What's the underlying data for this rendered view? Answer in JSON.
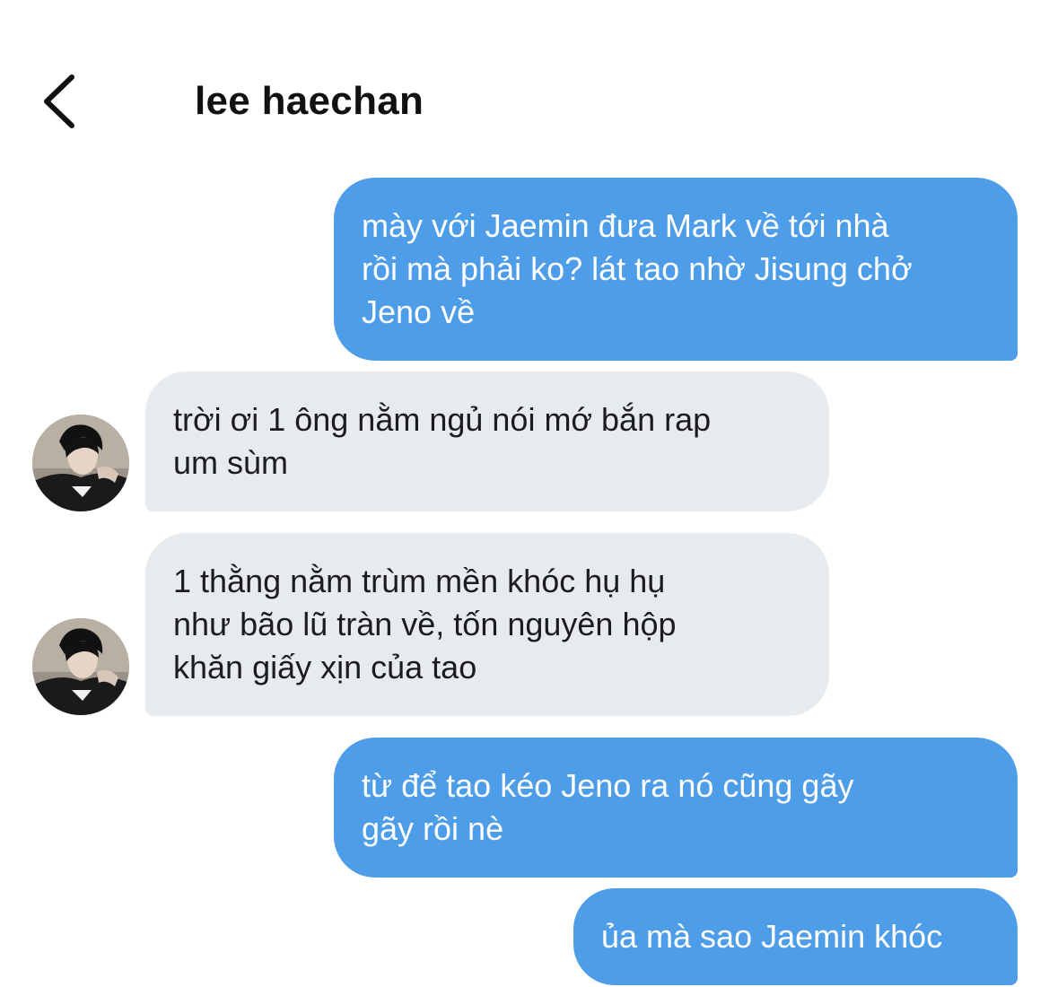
{
  "header": {
    "back_icon": "chevron-left-icon",
    "title": "lee haechan"
  },
  "colors": {
    "outgoing_bubble": "#4e9de8",
    "incoming_bubble": "#e8ebee",
    "outgoing_text": "#ffffff",
    "incoming_text": "#1c1c1e"
  },
  "messages": [
    {
      "direction": "outgoing",
      "text": "mày với Jaemin đưa Mark về tới nhà\nrồi mà phải ko? lát tao nhờ Jisung chở\nJeno về"
    },
    {
      "direction": "incoming",
      "text": "trời ơi 1 ông nằm ngủ nói mớ bắn rap\num sùm"
    },
    {
      "direction": "incoming",
      "text": "1 thằng nằm trùm mền khóc hụ hụ\nnhư bão lũ tràn về, tốn nguyên hộp\nkhăn giấy xịn của tao"
    },
    {
      "direction": "outgoing",
      "text": "từ để tao kéo Jeno ra nó cũng gãy\ngãy rồi nè"
    },
    {
      "direction": "outgoing",
      "text": "ủa mà sao Jaemin khóc"
    }
  ]
}
